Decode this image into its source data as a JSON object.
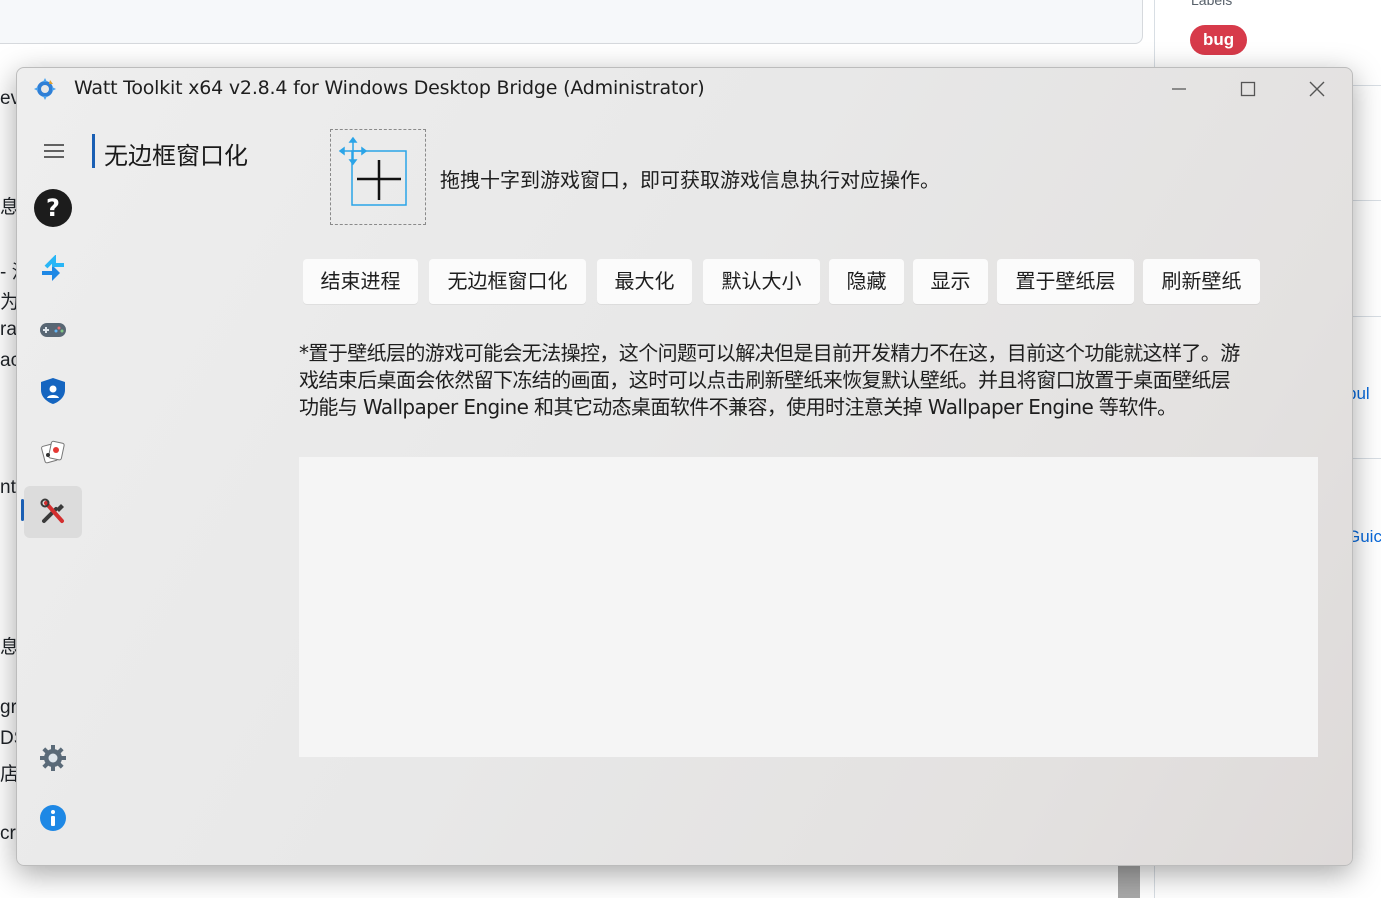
{
  "background_page": {
    "labels_heading": "Labels",
    "bug_label": "bug",
    "right_fragments": [
      "pul",
      "Guic"
    ],
    "left_fragments": [
      "ev",
      "息",
      "- 汉",
      "为",
      "ra",
      "ac",
      "nt",
      "息",
      "gr",
      "DS",
      "店",
      "cr"
    ]
  },
  "window": {
    "title": "Watt Toolkit x64 v2.8.4 for Windows Desktop Bridge (Administrator)",
    "controls": {
      "minimize": "minimize",
      "maximize": "maximize",
      "close": "close"
    }
  },
  "nav": {
    "items": [
      {
        "id": "help",
        "icon": "question-icon"
      },
      {
        "id": "accelerator",
        "icon": "network-accelerate-icon"
      },
      {
        "id": "game",
        "icon": "gamepad-icon"
      },
      {
        "id": "authenticator",
        "icon": "shield-icon"
      },
      {
        "id": "game-list",
        "icon": "cards-icon"
      },
      {
        "id": "tools",
        "icon": "tools-icon",
        "active": true
      }
    ],
    "bottom": [
      {
        "id": "settings",
        "icon": "gear-icon"
      },
      {
        "id": "about",
        "icon": "info-icon"
      }
    ]
  },
  "page": {
    "title": "无边框窗口化",
    "instruction": "拖拽十字到游戏窗口，即可获取游戏信息执行对应操作。",
    "buttons": [
      "结束进程",
      "无边框窗口化",
      "最大化",
      "默认大小",
      "隐藏",
      "显示",
      "置于壁纸层",
      "刷新壁纸"
    ],
    "note_lines": [
      "*置于壁纸层的游戏可能会无法操控，这个问题可以解决但是目前开发精力不在这，目前这个功能就这样了。游",
      "戏结束后桌面会依然留下冻结的画面，这时可以点击刷新壁纸来恢复默认壁纸。并且将窗口放置于桌面壁纸层",
      "功能与 Wallpaper Engine 和其它动态桌面软件不兼容，使用时注意关掉 Wallpaper Engine 等软件。"
    ],
    "log_text": ""
  },
  "colors": {
    "accent": "#1a5fb4",
    "bug_label": "#d73a4a",
    "window_bg": "#e8e8e8",
    "button_bg": "#fbfbfb",
    "log_bg": "#f5f5f5"
  }
}
